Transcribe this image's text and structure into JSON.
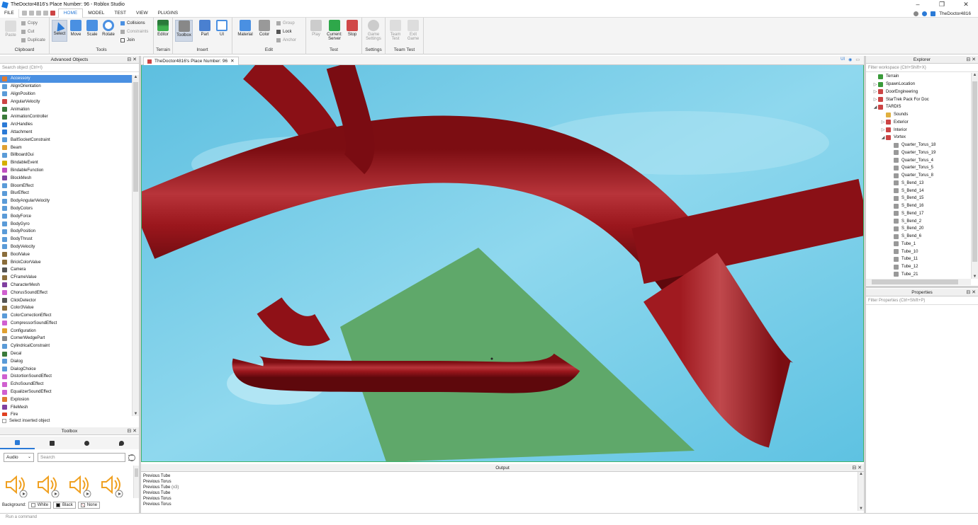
{
  "window": {
    "title": "TheDoctor4816's Place Number: 96 - Roblox Studio",
    "controls": [
      "–",
      "❐",
      "✕"
    ]
  },
  "menu": {
    "file": "FILE",
    "tabs": [
      "HOME",
      "MODEL",
      "TEST",
      "VIEW",
      "PLUGINS"
    ],
    "active_tab": "HOME",
    "username": "TheDoctor4816"
  },
  "ribbon": {
    "clipboard": {
      "label": "Clipboard",
      "paste": "Paste",
      "copy": "Copy",
      "cut": "Cut",
      "duplicate": "Duplicate"
    },
    "tools": {
      "label": "Tools",
      "select": "Select",
      "move": "Move",
      "scale": "Scale",
      "rotate": "Rotate",
      "collisions": "Collisions",
      "constraints": "Constraints",
      "join": "Join"
    },
    "terrain": {
      "label": "Terrain",
      "editor": "Editor"
    },
    "insert": {
      "label": "Insert",
      "toolbox": "Toolbox",
      "part": "Part",
      "ui": "UI"
    },
    "edit": {
      "label": "Edit",
      "material": "Material",
      "color": "Color",
      "group": "Group",
      "lock": "Lock",
      "anchor": "Anchor"
    },
    "test": {
      "label": "Test",
      "play": "Play",
      "current": "Current:",
      "server": "Server",
      "stop": "Stop"
    },
    "settings": {
      "label": "Settings",
      "game_settings_1": "Game",
      "game_settings_2": "Settings"
    },
    "team_test": {
      "label": "Team Test",
      "team_1": "Team",
      "team_2": "Test",
      "exit_1": "Exit",
      "exit_2": "Game"
    }
  },
  "advanced_objects": {
    "title": "Advanced Objects",
    "search_placeholder": "Search object (Ctrl+I)",
    "items": [
      {
        "name": "Accessory",
        "color": "#e07a30"
      },
      {
        "name": "AlignOrientation",
        "color": "#5a9bd8"
      },
      {
        "name": "AlignPosition",
        "color": "#5a9bd8"
      },
      {
        "name": "AngularVelocity",
        "color": "#c44"
      },
      {
        "name": "Animation",
        "color": "#3a7a3a"
      },
      {
        "name": "AnimationController",
        "color": "#3a7a3a"
      },
      {
        "name": "ArcHandles",
        "color": "#2b7ad6"
      },
      {
        "name": "Attachment",
        "color": "#2b7ad6"
      },
      {
        "name": "BallSocketConstraint",
        "color": "#5a9bd8"
      },
      {
        "name": "Beam",
        "color": "#e0a030"
      },
      {
        "name": "BillboardGui",
        "color": "#5a9bd8"
      },
      {
        "name": "BindableEvent",
        "color": "#d4b000"
      },
      {
        "name": "BindableFunction",
        "color": "#c050c0"
      },
      {
        "name": "BlockMesh",
        "color": "#8040a0"
      },
      {
        "name": "BloomEffect",
        "color": "#5a9bd8"
      },
      {
        "name": "BlurEffect",
        "color": "#5a9bd8"
      },
      {
        "name": "BodyAngularVelocity",
        "color": "#5a9bd8"
      },
      {
        "name": "BodyColors",
        "color": "#5a9bd8"
      },
      {
        "name": "BodyForce",
        "color": "#5a9bd8"
      },
      {
        "name": "BodyGyro",
        "color": "#5a9bd8"
      },
      {
        "name": "BodyPosition",
        "color": "#5a9bd8"
      },
      {
        "name": "BodyThrust",
        "color": "#5a9bd8"
      },
      {
        "name": "BodyVelocity",
        "color": "#5a9bd8"
      },
      {
        "name": "BoolValue",
        "color": "#8a6d3b"
      },
      {
        "name": "BrickColorValue",
        "color": "#8a6d3b"
      },
      {
        "name": "Camera",
        "color": "#555"
      },
      {
        "name": "CFrameValue",
        "color": "#8a6d3b"
      },
      {
        "name": "CharacterMesh",
        "color": "#8040a0"
      },
      {
        "name": "ChorusSoundEffect",
        "color": "#d060d0"
      },
      {
        "name": "ClickDetector",
        "color": "#555"
      },
      {
        "name": "Color3Value",
        "color": "#8a6d3b"
      },
      {
        "name": "ColorCorrectionEffect",
        "color": "#5a9bd8"
      },
      {
        "name": "CompressorSoundEffect",
        "color": "#d060d0"
      },
      {
        "name": "Configuration",
        "color": "#e0a030"
      },
      {
        "name": "CornerWedgePart",
        "color": "#888"
      },
      {
        "name": "CylindricalConstraint",
        "color": "#5a9bd8"
      },
      {
        "name": "Decal",
        "color": "#3a7a3a"
      },
      {
        "name": "Dialog",
        "color": "#5a9bd8"
      },
      {
        "name": "DialogChoice",
        "color": "#5a9bd8"
      },
      {
        "name": "DistortionSoundEffect",
        "color": "#d060d0"
      },
      {
        "name": "EchoSoundEffect",
        "color": "#d060d0"
      },
      {
        "name": "EqualizerSoundEffect",
        "color": "#d060d0"
      },
      {
        "name": "Explosion",
        "color": "#e07a30"
      },
      {
        "name": "FileMesh",
        "color": "#8040a0"
      },
      {
        "name": "Fire",
        "color": "#e04020"
      }
    ],
    "select_inserted": "Select inserted object"
  },
  "toolbox": {
    "title": "Toolbox",
    "category": "Audio",
    "search_placeholder": "Search",
    "background_label": "Background:",
    "bg_white": "White",
    "bg_black": "Black",
    "bg_none": "None"
  },
  "viewport": {
    "tab_title": "TheDoctor4816's Place Number: 96",
    "tab_close": "✕",
    "ui_toggle": "UI"
  },
  "explorer": {
    "title": "Explorer",
    "filter_placeholder": "Filter workspace (Ctrl+Shift+X)",
    "items": [
      {
        "name": "Terrain",
        "depth": 1,
        "arrow": "",
        "color": "#3a9a3a"
      },
      {
        "name": "SpawnLocation",
        "depth": 1,
        "arrow": "▷",
        "color": "#3a9a3a"
      },
      {
        "name": "DoorEngineering",
        "depth": 1,
        "arrow": "▷",
        "color": "#c44"
      },
      {
        "name": "StarTrek Pack For Doc",
        "depth": 1,
        "arrow": "▷",
        "color": "#c44"
      },
      {
        "name": "TARDIS",
        "depth": 1,
        "arrow": "◢",
        "color": "#c44"
      },
      {
        "name": "Sounds",
        "depth": 2,
        "arrow": "",
        "color": "#e0b040"
      },
      {
        "name": "Exterior",
        "depth": 2,
        "arrow": "▷",
        "color": "#c44"
      },
      {
        "name": "Interior",
        "depth": 2,
        "arrow": "▷",
        "color": "#c44"
      },
      {
        "name": "Vortex",
        "depth": 2,
        "arrow": "◢",
        "color": "#c44"
      },
      {
        "name": "Quarter_Torus_18",
        "depth": 3,
        "arrow": "",
        "color": "#999"
      },
      {
        "name": "Quarter_Torus_19",
        "depth": 3,
        "arrow": "",
        "color": "#999"
      },
      {
        "name": "Quarter_Torus_4",
        "depth": 3,
        "arrow": "",
        "color": "#999"
      },
      {
        "name": "Quarter_Torus_5",
        "depth": 3,
        "arrow": "",
        "color": "#999"
      },
      {
        "name": "Quarter_Torus_8",
        "depth": 3,
        "arrow": "",
        "color": "#999"
      },
      {
        "name": "S_Bend_13",
        "depth": 3,
        "arrow": "",
        "color": "#999"
      },
      {
        "name": "S_Bend_14",
        "depth": 3,
        "arrow": "",
        "color": "#999"
      },
      {
        "name": "S_Bend_15",
        "depth": 3,
        "arrow": "",
        "color": "#999"
      },
      {
        "name": "S_Bend_16",
        "depth": 3,
        "arrow": "",
        "color": "#999"
      },
      {
        "name": "S_Bend_17",
        "depth": 3,
        "arrow": "",
        "color": "#999"
      },
      {
        "name": "S_Bend_2",
        "depth": 3,
        "arrow": "",
        "color": "#999"
      },
      {
        "name": "S_Bend_20",
        "depth": 3,
        "arrow": "",
        "color": "#999"
      },
      {
        "name": "S_Bend_6",
        "depth": 3,
        "arrow": "",
        "color": "#999"
      },
      {
        "name": "Tube_1",
        "depth": 3,
        "arrow": "",
        "color": "#999"
      },
      {
        "name": "Tube_10",
        "depth": 3,
        "arrow": "",
        "color": "#999"
      },
      {
        "name": "Tube_11",
        "depth": 3,
        "arrow": "",
        "color": "#999"
      },
      {
        "name": "Tube_12",
        "depth": 3,
        "arrow": "",
        "color": "#999"
      },
      {
        "name": "Tube_21",
        "depth": 3,
        "arrow": "",
        "color": "#999"
      }
    ]
  },
  "properties": {
    "title": "Properties",
    "filter_placeholder": "Filter Properties (Ctrl+Shift+P)"
  },
  "output": {
    "title": "Output",
    "lines": [
      {
        "text": "Previous Tube",
        "count": ""
      },
      {
        "text": "Previous Torus",
        "count": ""
      },
      {
        "text": "Previous Tube",
        "count": "(x3)"
      },
      {
        "text": "Previous Tube",
        "count": ""
      },
      {
        "text": "Previous Torus",
        "count": ""
      },
      {
        "text": "Previous Torus",
        "count": ""
      }
    ]
  },
  "command_bar": {
    "placeholder": "Run a command"
  },
  "colors": {
    "accent": "#2b7ad6",
    "selection": "#4a90e2",
    "sky": "#6cc6e4",
    "baseplate": "#5fa86a",
    "tube": "#9a1418"
  }
}
